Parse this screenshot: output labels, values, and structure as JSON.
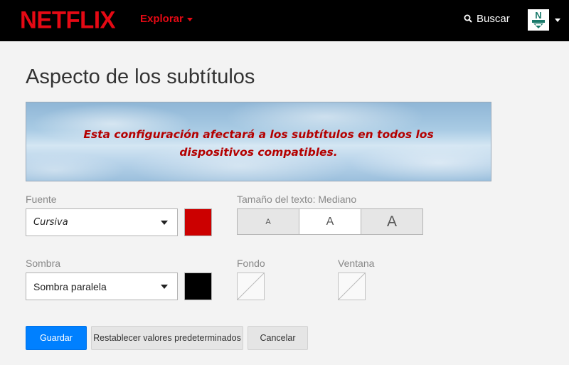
{
  "header": {
    "logo": "NETFLIX",
    "explore_label": "Explorar",
    "search_label": "Buscar",
    "brand_color": "#e50914"
  },
  "page": {
    "title": "Aspecto de los subtítulos",
    "preview_text": "Esta configuración afectará a los subtítulos en todos los dispositivos compatibles."
  },
  "font": {
    "label": "Fuente",
    "selected": "Cursiva",
    "color": "#cc0000"
  },
  "text_size": {
    "label": "Tamaño del texto: Mediano",
    "options": [
      "A",
      "A",
      "A"
    ],
    "selected_index": 1
  },
  "shadow": {
    "label": "Sombra",
    "selected": "Sombra paralela",
    "color": "#000000"
  },
  "background": {
    "label": "Fondo"
  },
  "window": {
    "label": "Ventana"
  },
  "buttons": {
    "save": "Guardar",
    "reset": "Restablecer valores predeterminados",
    "cancel": "Cancelar"
  }
}
